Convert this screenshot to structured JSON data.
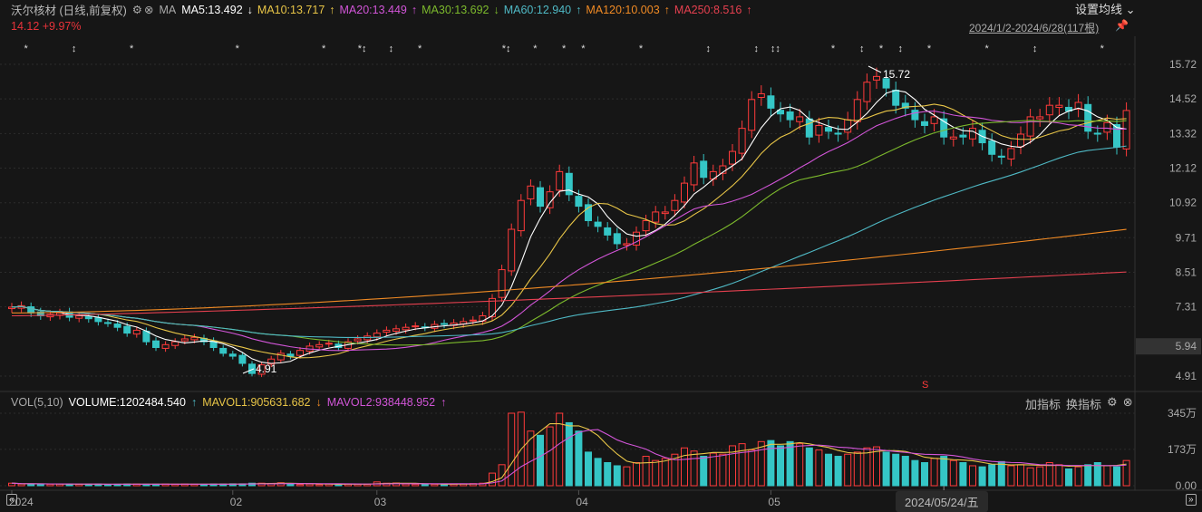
{
  "header": {
    "title": "沃尔核材 (日线,前复权)",
    "ma_label": "MA",
    "ma": [
      {
        "text": "MA5:13.492",
        "arrow": "↓",
        "color": "#ffffff"
      },
      {
        "text": "MA10:13.717",
        "arrow": "↑",
        "color": "#e8c547"
      },
      {
        "text": "MA20:13.449",
        "arrow": "↑",
        "color": "#d255d8"
      },
      {
        "text": "MA30:13.692",
        "arrow": "↓",
        "color": "#7cb92c"
      },
      {
        "text": "MA60:12.940",
        "arrow": "↑",
        "color": "#4fb9c5"
      },
      {
        "text": "MA120:10.003",
        "arrow": "↑",
        "color": "#f08a24"
      },
      {
        "text": "MA250:8.516",
        "arrow": "↑",
        "color": "#e5404f"
      }
    ],
    "price_line": "14.12 +9.97%",
    "settings_label": "设置均线 ⌄",
    "range_label": "2024/1/2-2024/6/28(117根)"
  },
  "volume_header": {
    "name": "VOL(5,10)",
    "volume": "VOLUME:1202484.540",
    "volume_arrow": "↑",
    "mavol1": "MAVOL1:905631.682",
    "mavol1_arrow": "↓",
    "mavol2": "MAVOL2:938448.952",
    "mavol2_arrow": "↑",
    "add_indicator": "加指标",
    "switch_indicator": "换指标"
  },
  "crosshair_date": "2024/05/24/五",
  "annotations": {
    "high": "15.72",
    "low": "4.91",
    "marker": "S"
  },
  "chart_data": {
    "type": "candlestick",
    "price_ticks": [
      "15.72",
      "14.52",
      "13.32",
      "12.12",
      "10.92",
      "9.71",
      "8.51",
      "7.31",
      "5.94",
      "4.91"
    ],
    "price_tick_values": [
      15.72,
      14.52,
      13.32,
      12.12,
      10.92,
      9.71,
      8.51,
      7.31,
      5.94,
      4.91
    ],
    "current_price_tag": "5.94",
    "volume_ticks": [
      "345万",
      "173万",
      "0.00"
    ],
    "volume_tick_values": [
      345,
      173,
      0
    ],
    "x_labels": [
      {
        "bar": 0,
        "label": "2024"
      },
      {
        "bar": 23,
        "label": "02"
      },
      {
        "bar": 38,
        "label": "03"
      },
      {
        "bar": 59,
        "label": "04"
      },
      {
        "bar": 79,
        "label": "05"
      }
    ],
    "open0": 7.25,
    "close": [
      7.3,
      7.35,
      7.1,
      7.0,
      7.05,
      7.1,
      6.95,
      7.0,
      6.9,
      6.8,
      6.75,
      6.6,
      6.4,
      6.5,
      6.1,
      5.9,
      6.0,
      6.1,
      6.2,
      6.25,
      6.1,
      5.9,
      5.7,
      5.6,
      5.35,
      5.0,
      5.3,
      5.5,
      5.7,
      5.6,
      5.8,
      5.95,
      6.0,
      6.05,
      5.9,
      6.1,
      6.2,
      6.3,
      6.4,
      6.5,
      6.55,
      6.6,
      6.65,
      6.6,
      6.7,
      6.7,
      6.75,
      6.8,
      6.85,
      7.0,
      7.6,
      8.6,
      10.0,
      11.0,
      11.5,
      10.8,
      11.3,
      12.0,
      11.2,
      10.8,
      10.3,
      10.1,
      9.8,
      9.5,
      9.5,
      9.9,
      10.3,
      10.6,
      10.6,
      11.0,
      11.6,
      12.3,
      11.8,
      12.0,
      12.2,
      12.7,
      13.5,
      14.5,
      14.7,
      14.2,
      14.0,
      13.8,
      13.9,
      13.2,
      13.6,
      13.4,
      13.3,
      13.8,
      14.5,
      15.1,
      15.3,
      14.9,
      14.3,
      14.2,
      13.8,
      13.6,
      13.9,
      13.2,
      13.2,
      13.2,
      13.5,
      13.0,
      12.6,
      12.5,
      12.8,
      13.3,
      13.9,
      13.9,
      14.3,
      14.3,
      14.1,
      14.4,
      13.4,
      13.3,
      13.7,
      12.85,
      14.12
    ],
    "volume": [
      12,
      8,
      8,
      8,
      7,
      8,
      7,
      7,
      7,
      8,
      6,
      7,
      8,
      8,
      7,
      7,
      8,
      7,
      8,
      7,
      6,
      8,
      8,
      9,
      9,
      12,
      12,
      11,
      14,
      10,
      6,
      8,
      6,
      8,
      6,
      8,
      8,
      7,
      18,
      12,
      13,
      8,
      7,
      8,
      7,
      7,
      8,
      8,
      10,
      12,
      60,
      100,
      345,
      350,
      260,
      240,
      280,
      345,
      300,
      260,
      160,
      130,
      110,
      95,
      90,
      110,
      140,
      120,
      130,
      150,
      180,
      165,
      140,
      155,
      150,
      190,
      200,
      170,
      210,
      215,
      190,
      210,
      200,
      180,
      170,
      150,
      140,
      150,
      160,
      180,
      185,
      160,
      150,
      140,
      120,
      110,
      130,
      140,
      120,
      110,
      95,
      90,
      100,
      115,
      95,
      100,
      85,
      90,
      110,
      100,
      80,
      90,
      100,
      110,
      95,
      90,
      120
    ],
    "ma120_range": [
      7.1,
      10.0
    ],
    "ma250_range": [
      7.0,
      8.52
    ],
    "markers": [
      {
        "bar": 1,
        "s": "*"
      },
      {
        "bar": 6,
        "s": "↕"
      },
      {
        "bar": 12,
        "s": "*"
      },
      {
        "bar": 23,
        "s": "*"
      },
      {
        "bar": 32,
        "s": "*"
      },
      {
        "bar": 36,
        "s": "*↕"
      },
      {
        "bar": 39,
        "s": "↕"
      },
      {
        "bar": 42,
        "s": "*"
      },
      {
        "bar": 51,
        "s": "*↕"
      },
      {
        "bar": 54,
        "s": "*"
      },
      {
        "bar": 57,
        "s": "*"
      },
      {
        "bar": 59,
        "s": "*"
      },
      {
        "bar": 65,
        "s": "*"
      },
      {
        "bar": 72,
        "s": "↕"
      },
      {
        "bar": 77,
        "s": "↕"
      },
      {
        "bar": 79,
        "s": "↕↕"
      },
      {
        "bar": 85,
        "s": "*"
      },
      {
        "bar": 88,
        "s": "↕"
      },
      {
        "bar": 90,
        "s": "*"
      },
      {
        "bar": 92,
        "s": "↕"
      },
      {
        "bar": 95,
        "s": "*"
      },
      {
        "bar": 101,
        "s": "*"
      },
      {
        "bar": 106,
        "s": "↕"
      },
      {
        "bar": 113,
        "s": "*"
      }
    ]
  }
}
